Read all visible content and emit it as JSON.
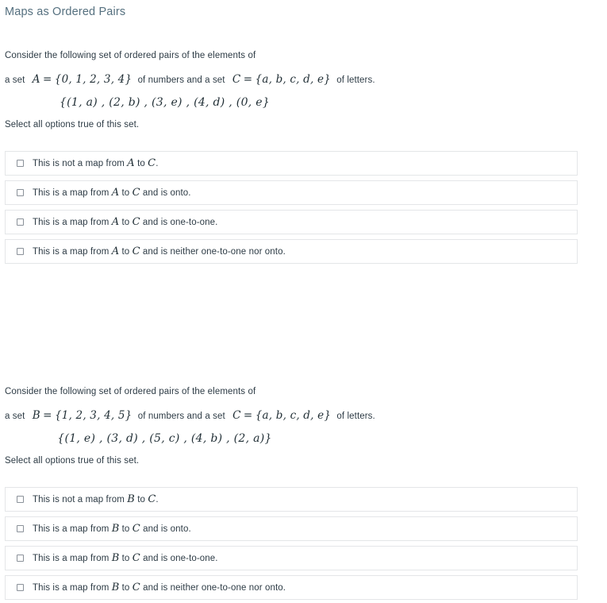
{
  "page": {
    "title": "Maps as Ordered Pairs"
  },
  "questions": [
    {
      "intro": "Consider the following set of ordered pairs of the elements of",
      "setdef": {
        "lead": "a set",
        "domain_name": "A",
        "domain_eq": "=",
        "domain_set": "{0, 1, 2, 3, 4}",
        "middle": "of numbers and a set",
        "codomain_name": "C",
        "codomain_eq": "=",
        "codomain_set": "{a, b, c, d, e}",
        "tail": "of letters."
      },
      "pairs": "{(1, a) , (2, b) , (3, e) , (4, d) , (0, e}",
      "instruction": "Select all options true of this set.",
      "options": [
        {
          "prefix": "This is not a map from",
          "var1": "A",
          "mid": "to",
          "var2": "C",
          "suffix": "."
        },
        {
          "prefix": "This is a map from",
          "var1": "A",
          "mid": "to",
          "var2": "C",
          "suffix": "and is onto."
        },
        {
          "prefix": "This is a map from",
          "var1": "A",
          "mid": "to",
          "var2": "C",
          "suffix": "and is one-to-one."
        },
        {
          "prefix": "This is a map from",
          "var1": "A",
          "mid": "to",
          "var2": "C",
          "suffix": "and is neither one-to-one nor onto."
        }
      ]
    },
    {
      "intro": "Consider the following set of ordered pairs of the elements of",
      "setdef": {
        "lead": "a set",
        "domain_name": "B",
        "domain_eq": "=",
        "domain_set": "{1, 2, 3, 4, 5}",
        "middle": "of numbers and a set",
        "codomain_name": "C",
        "codomain_eq": "=",
        "codomain_set": "{a, b, c, d, e}",
        "tail": "of letters."
      },
      "pairs": "{(1, e) , (3, d) , (5, c) , (4, b) , (2, a)}",
      "instruction": "Select all options true of this set.",
      "options": [
        {
          "prefix": "This is not a map from",
          "var1": "B",
          "mid": "to",
          "var2": "C",
          "suffix": "."
        },
        {
          "prefix": "This is a map from",
          "var1": "B",
          "mid": "to",
          "var2": "C",
          "suffix": "and is onto."
        },
        {
          "prefix": "This is a map from",
          "var1": "B",
          "mid": "to",
          "var2": "C",
          "suffix": "and is one-to-one."
        },
        {
          "prefix": "This is a map from",
          "var1": "B",
          "mid": "to",
          "var2": "C",
          "suffix": "and is neither one-to-one nor onto."
        }
      ]
    }
  ],
  "colors": {
    "title": "#55707f",
    "body_text": "#2d3b45",
    "option_border": "#e4e6e8",
    "checkbox_border": "#8a9199",
    "background": "#ffffff"
  }
}
